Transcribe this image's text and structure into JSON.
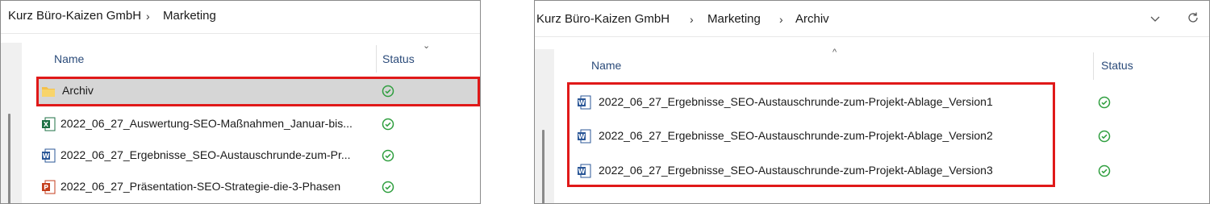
{
  "left": {
    "breadcrumb": [
      "Kurz Büro-Kaizen GmbH",
      "Marketing"
    ],
    "columns": {
      "name": "Name",
      "status": "Status"
    },
    "rows": [
      {
        "label": "Archiv",
        "icon": "folder-icon",
        "selected": true
      },
      {
        "label": "2022_06_27_Auswertung-SEO-Maßnahmen_Januar-bis...",
        "icon": "excel-file-icon"
      },
      {
        "label": "2022_06_27_Ergebnisse_SEO-Austauschrunde-zum-Pr...",
        "icon": "word-file-icon"
      },
      {
        "label": "2022_06_27_Präsentation-SEO-Strategie-die-3-Phasen",
        "icon": "powerpoint-file-icon"
      }
    ]
  },
  "right": {
    "breadcrumb": [
      "Kurz Büro-Kaizen GmbH",
      "Marketing",
      "Archiv"
    ],
    "columns": {
      "name": "Name",
      "status": "Status"
    },
    "rows": [
      {
        "label": "2022_06_27_Ergebnisse_SEO-Austauschrunde-zum-Projekt-Ablage_Version1",
        "icon": "word-file-icon"
      },
      {
        "label": "2022_06_27_Ergebnisse_SEO-Austauschrunde-zum-Projekt-Ablage_Version2",
        "icon": "word-file-icon"
      },
      {
        "label": "2022_06_27_Ergebnisse_SEO-Austauschrunde-zum-Projekt-Ablage_Version3",
        "icon": "word-file-icon"
      }
    ]
  },
  "colors": {
    "highlight": "#e01919",
    "status_ok": "#2e9e3e",
    "word": "#2b5797",
    "excel": "#1d7044",
    "powerpoint": "#c43e1c",
    "folder": "#f4c04a"
  }
}
